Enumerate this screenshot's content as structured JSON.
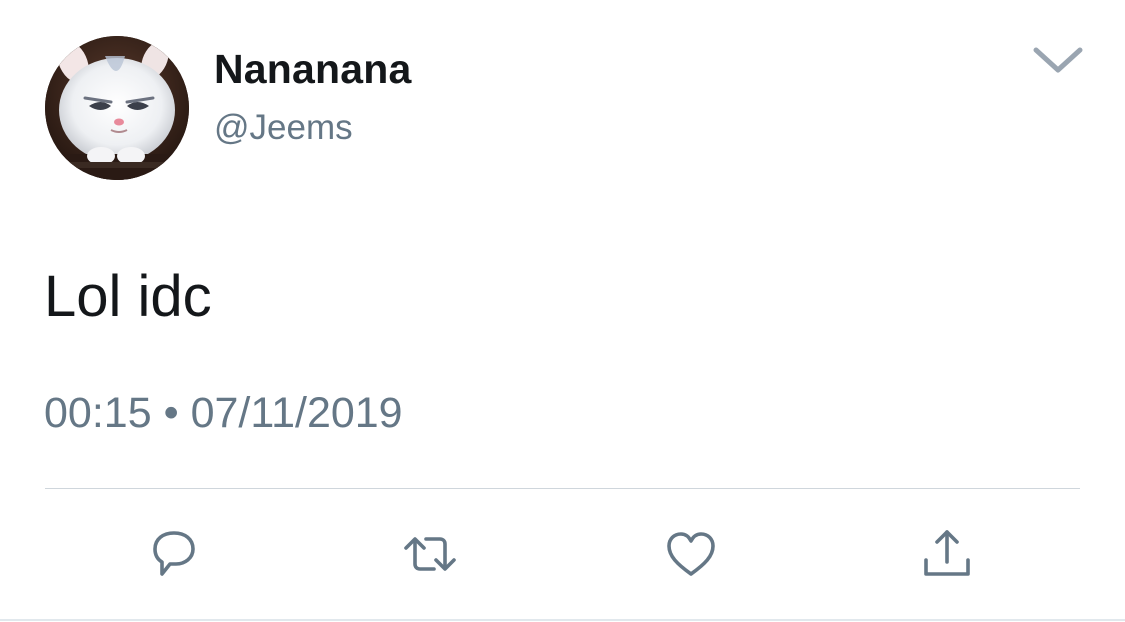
{
  "tweet": {
    "display_name": "Nananana",
    "handle": "@Jeems",
    "text": "Lol idc",
    "time": "00:15",
    "separator": "•",
    "date": "07/11/2019"
  },
  "icons": {
    "menu": "chevron-down-icon",
    "reply": "reply-bubble-icon",
    "retweet": "retweet-icon",
    "like": "heart-icon",
    "share": "share-icon"
  },
  "colors": {
    "primary_text": "#14171a",
    "secondary_text": "#657786",
    "icon": "#657786",
    "divider": "#cfd6dc",
    "background": "#ffffff"
  }
}
